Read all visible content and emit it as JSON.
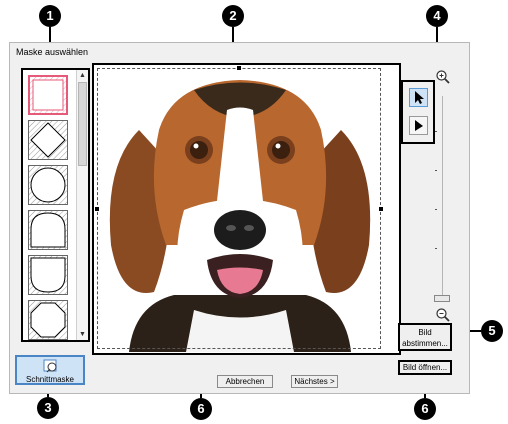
{
  "dialog": {
    "title": "Maske auswählen"
  },
  "mask_list": {
    "items": [
      {
        "shape": "square",
        "selected": true
      },
      {
        "shape": "diamond",
        "selected": false
      },
      {
        "shape": "circle",
        "selected": false
      },
      {
        "shape": "arch",
        "selected": false
      },
      {
        "shape": "shield",
        "selected": false
      },
      {
        "shape": "octagon",
        "selected": false
      }
    ]
  },
  "tools": {
    "select": {
      "icon": "arrow-cursor-icon",
      "active": true
    },
    "move": {
      "icon": "arrow-cursor-icon",
      "active": false
    }
  },
  "zoom": {
    "in_icon": "zoom-in-icon",
    "out_icon": "zoom-out-icon"
  },
  "buttons": {
    "fit_image_line1": "Bild",
    "fit_image_line2": "abstimmen...",
    "open_image": "Bild öffnen...",
    "cancel": "Abbrechen",
    "next": "Nächstes >",
    "cut_mask": "Schnittmaske"
  },
  "callouts": [
    "1",
    "2",
    "3",
    "4",
    "5",
    "6",
    "6"
  ],
  "colors": {
    "selected_mask_border": "#e45a78",
    "active_tool": "#cfe3f7",
    "cut_mask_button": "#cfe3f7"
  }
}
